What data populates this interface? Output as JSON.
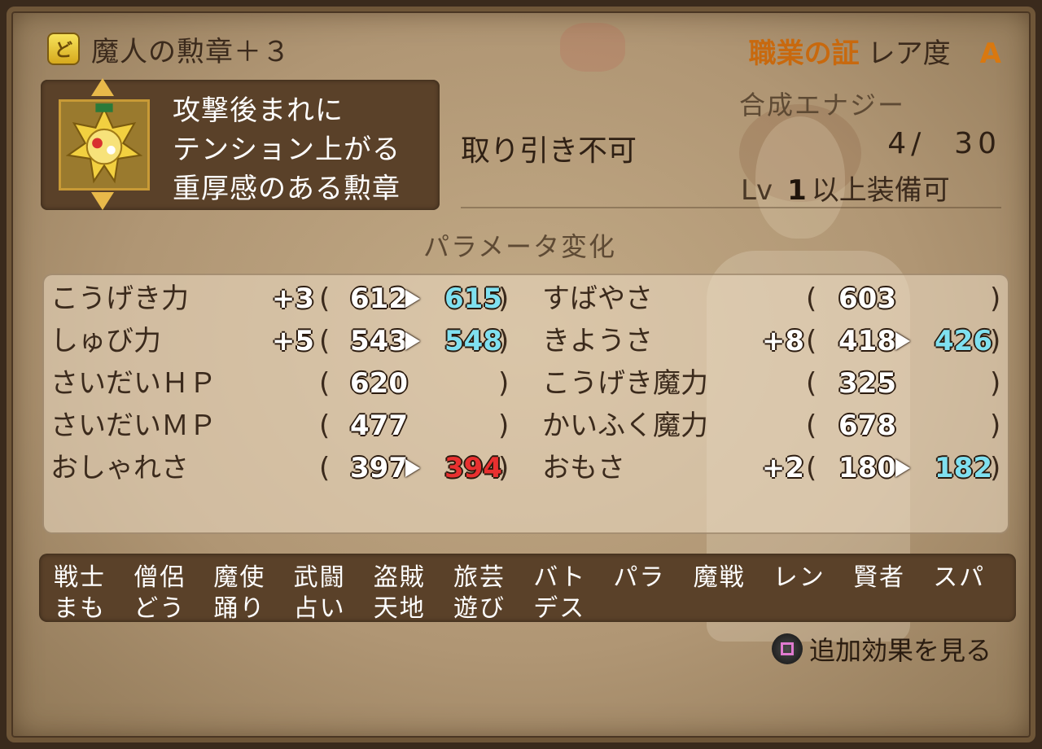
{
  "item": {
    "name": "魔人の勲章＋３",
    "category": "職業の証",
    "rarity_label": "レア度",
    "rarity_value": "A",
    "description": [
      "攻撃後まれに",
      "テンション上がる",
      "重厚感のある勲章"
    ],
    "tradable": "取り引き不可",
    "energy_label": "合成エナジー",
    "energy_value": "4/  30",
    "level_label": "Lv",
    "level_value": "1",
    "level_suffix": "以上装備可"
  },
  "params": {
    "title": "パラメータ変化",
    "left": [
      {
        "name": "こうげき力",
        "bonus": "+3",
        "current": "612",
        "new": "615",
        "dir": "up"
      },
      {
        "name": "しゅび力",
        "bonus": "+5",
        "current": "543",
        "new": "548",
        "dir": "up"
      },
      {
        "name": "さいだいＨＰ",
        "bonus": "",
        "current": "620",
        "new": "",
        "dir": ""
      },
      {
        "name": "さいだいＭＰ",
        "bonus": "",
        "current": "477",
        "new": "",
        "dir": ""
      },
      {
        "name": "おしゃれさ",
        "bonus": "",
        "current": "397",
        "new": "394",
        "dir": "down"
      }
    ],
    "right": [
      {
        "name": "すばやさ",
        "bonus": "",
        "current": "603",
        "new": "",
        "dir": ""
      },
      {
        "name": "きようさ",
        "bonus": "+8",
        "current": "418",
        "new": "426",
        "dir": "up"
      },
      {
        "name": "こうげき魔力",
        "bonus": "",
        "current": "325",
        "new": "",
        "dir": ""
      },
      {
        "name": "かいふく魔力",
        "bonus": "",
        "current": "678",
        "new": "",
        "dir": ""
      },
      {
        "name": "おもさ",
        "bonus": "+2",
        "current": "180",
        "new": "182",
        "dir": "up"
      }
    ]
  },
  "jobs": {
    "row1": [
      "戦士",
      "僧侶",
      "魔使",
      "武闘",
      "盗賊",
      "旅芸",
      "バト",
      "パラ",
      "魔戦",
      "レン",
      "賢者",
      "スパ"
    ],
    "row2": [
      "まも",
      "どう",
      "踊り",
      "占い",
      "天地",
      "遊び",
      "デス"
    ]
  },
  "footer": {
    "button_icon": "square-button-icon",
    "extra_effects_label": "追加効果を見る"
  },
  "colors": {
    "increase": "#7fe0f0",
    "decrease": "#e83030",
    "accent_orange": "#c8690e"
  }
}
